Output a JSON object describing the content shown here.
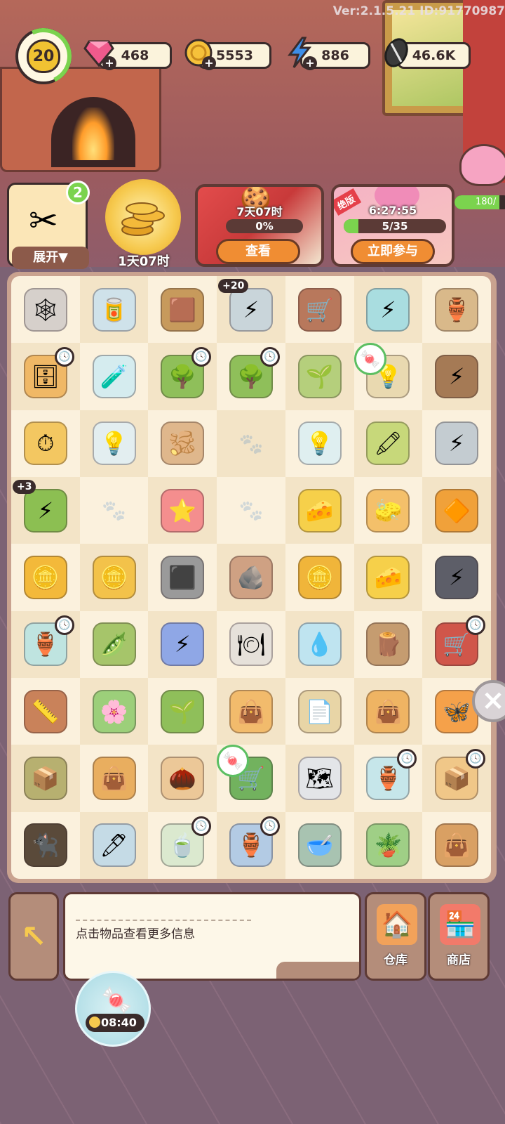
{
  "version_text": "Ver:2.1.5.21 ID:91770987",
  "player": {
    "level": "20"
  },
  "resources": {
    "gems": "468",
    "coins": "5553",
    "energy": "886",
    "seeds": "46.6K"
  },
  "events": {
    "scissor_card": {
      "badge": "2",
      "label": "展开▼"
    },
    "coin_orb": {
      "timer": "1天07时"
    },
    "gingerbread": {
      "timer": "7天07时",
      "progress": "0%",
      "progress_fraction": 0.0,
      "button": "查看"
    },
    "blossom": {
      "ribbon": "绝版",
      "timer": "6:27:55",
      "progress": "5/35",
      "progress_fraction": 0.143,
      "button": "立即参与"
    },
    "piggy": {
      "progress": "180/",
      "progress_fraction": 0.8
    }
  },
  "board": {
    "rows": [
      [
        {
          "name": "cobweb-cart",
          "icon": "🕸",
          "bg": "#d6d0cb"
        },
        {
          "name": "paint-can",
          "icon": "🥫",
          "bg": "#cfe2ea"
        },
        {
          "name": "mud-tray",
          "icon": "🟫",
          "bg": "#c79a5c"
        },
        {
          "name": "energy-toolbox",
          "icon": "⚡",
          "bg": "#c9d5da",
          "bonus": "+20"
        },
        {
          "name": "wheelbarrow",
          "icon": "🛒",
          "bg": "#b8785c"
        },
        {
          "name": "energy-cabinet",
          "icon": "⚡",
          "bg": "#a9dde0"
        },
        {
          "name": "broken-pot",
          "icon": "🏺",
          "bg": "#d9b98a"
        }
      ],
      [
        {
          "name": "drawer",
          "icon": "🗄",
          "bg": "#f0b866",
          "clock": true
        },
        {
          "name": "bottle",
          "icon": "🧪",
          "bg": "#d5ecef"
        },
        {
          "name": "tree",
          "icon": "🌳",
          "bg": "#8fbf5a",
          "clock": true
        },
        {
          "name": "tree",
          "icon": "🌳",
          "bg": "#8fbf5a",
          "clock": true
        },
        {
          "name": "sapling",
          "icon": "🌱",
          "bg": "#b5cf7c"
        },
        {
          "name": "lamp",
          "icon": "💡",
          "bg": "#e9d9b0",
          "cane": true
        },
        {
          "name": "energy-wood",
          "icon": "⚡",
          "bg": "#a57a55"
        }
      ],
      [
        {
          "name": "pocket-watch",
          "icon": "⏱",
          "bg": "#f3c761"
        },
        {
          "name": "bulb",
          "icon": "💡",
          "bg": "#e3eef0"
        },
        {
          "name": "ginger",
          "icon": "🫚",
          "bg": "#dfb78c"
        },
        {
          "name": "empty",
          "icon": "🐾",
          "empty": true
        },
        {
          "name": "light-bulb",
          "icon": "💡",
          "bg": "#dfeff0"
        },
        {
          "name": "paint-tubes",
          "icon": "🖍",
          "bg": "#c7d87a"
        },
        {
          "name": "energy-cart",
          "icon": "⚡",
          "bg": "#c4ccd1"
        }
      ],
      [
        {
          "name": "energy-jar",
          "icon": "⚡",
          "bg": "#8cbf52",
          "bonus": "+3"
        },
        {
          "name": "empty",
          "icon": "🐾",
          "empty": true
        },
        {
          "name": "starfish",
          "icon": "⭐",
          "bg": "#f48e8e"
        },
        {
          "name": "empty",
          "icon": "🐾",
          "empty": true
        },
        {
          "name": "cheese-cube",
          "icon": "🧀",
          "bg": "#f6d04a"
        },
        {
          "name": "eraser",
          "icon": "🧽",
          "bg": "#f4c06a"
        },
        {
          "name": "amber",
          "icon": "🔶",
          "bg": "#f0a13a"
        }
      ],
      [
        {
          "name": "coin-stack",
          "icon": "🪙",
          "bg": "#f3b93a"
        },
        {
          "name": "coins",
          "icon": "🪙",
          "bg": "#f3c24a"
        },
        {
          "name": "iron-bar",
          "icon": "⬛",
          "bg": "#9a9a9a"
        },
        {
          "name": "ore",
          "icon": "🪨",
          "bg": "#cfa183"
        },
        {
          "name": "coins",
          "icon": "🪙",
          "bg": "#f0b53a"
        },
        {
          "name": "cheese",
          "icon": "🧀",
          "bg": "#f6d04a"
        },
        {
          "name": "energy-rock",
          "icon": "⚡",
          "bg": "#5d5e68"
        }
      ],
      [
        {
          "name": "vase",
          "icon": "🏺",
          "bg": "#bfe4e0",
          "clock": true
        },
        {
          "name": "beans",
          "icon": "🫛",
          "bg": "#a6c56a"
        },
        {
          "name": "energy-coin",
          "icon": "⚡",
          "bg": "#8fa7e6"
        },
        {
          "name": "plate",
          "icon": "🍽",
          "bg": "#e6e1da"
        },
        {
          "name": "dropper",
          "icon": "💧",
          "bg": "#bfe4f0"
        },
        {
          "name": "root",
          "icon": "🪵",
          "bg": "#c59c70"
        },
        {
          "name": "red-barrow",
          "icon": "🛒",
          "bg": "#d0564a",
          "clock": true
        }
      ],
      [
        {
          "name": "tape-measure",
          "icon": "📏",
          "bg": "#c9825a"
        },
        {
          "name": "flower-pot",
          "icon": "🌸",
          "bg": "#9ccf7a"
        },
        {
          "name": "sprout",
          "icon": "🌱",
          "bg": "#8fbf5a"
        },
        {
          "name": "seed-bag",
          "icon": "👜",
          "bg": "#f2bb6c"
        },
        {
          "name": "paper-stack",
          "icon": "📄",
          "bg": "#e8d5a6"
        },
        {
          "name": "seed-bags",
          "icon": "👜",
          "bg": "#efb463"
        },
        {
          "name": "butterfly",
          "icon": "🦋",
          "bg": "#f5a14a"
        }
      ],
      [
        {
          "name": "seed-box",
          "icon": "📦",
          "bg": "#b7b070"
        },
        {
          "name": "seed-pile",
          "icon": "👜",
          "bg": "#e9ae5f"
        },
        {
          "name": "seeds",
          "icon": "🌰",
          "bg": "#ecc898"
        },
        {
          "name": "green-cart",
          "icon": "🛒",
          "bg": "#72b25e",
          "cane": true
        },
        {
          "name": "map",
          "icon": "🗺",
          "bg": "#e3e5e8"
        },
        {
          "name": "glass-vase",
          "icon": "🏺",
          "bg": "#c6e6ea",
          "clock": true
        },
        {
          "name": "open-box",
          "icon": "📦",
          "bg": "#f0c788",
          "clock": true
        }
      ],
      [
        {
          "name": "black-cat",
          "icon": "🐈‍⬛",
          "bg": "#5a4a3a"
        },
        {
          "name": "pen",
          "icon": "🖊",
          "bg": "#c5dbe6"
        },
        {
          "name": "cup",
          "icon": "🍵",
          "bg": "#dbe9cf",
          "clock": true
        },
        {
          "name": "flower-vase",
          "icon": "🏺",
          "bg": "#b3cbe4",
          "clock": true
        },
        {
          "name": "bowl",
          "icon": "🥣",
          "bg": "#a8c3b1"
        },
        {
          "name": "planter",
          "icon": "🪴",
          "bg": "#9fcf86"
        },
        {
          "name": "sack-pile",
          "icon": "👜",
          "bg": "#d9a063"
        }
      ]
    ]
  },
  "bottom": {
    "hint": "点击物品查看更多信息",
    "warehouse_label": "仓库",
    "shop_label": "商店",
    "bubble_timer": "08:40"
  }
}
